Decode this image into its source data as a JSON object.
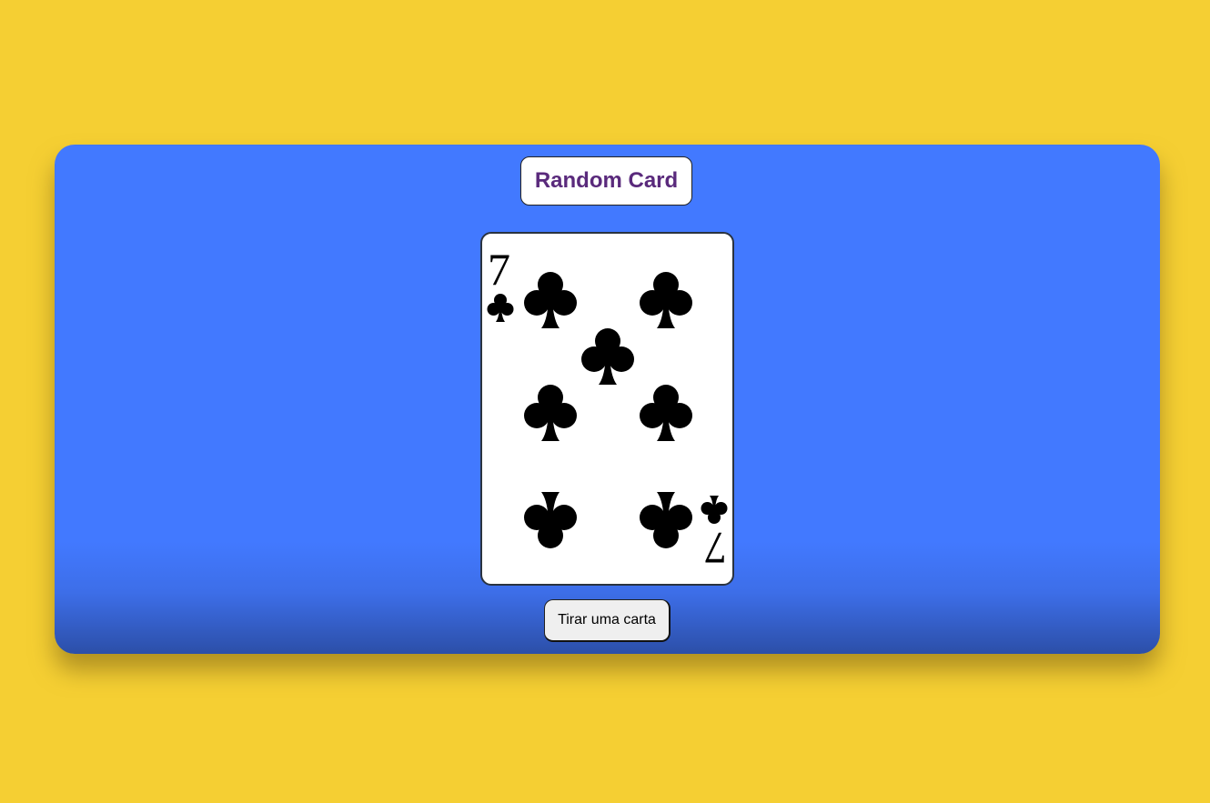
{
  "title": "Random Card",
  "card": {
    "rank": "7",
    "suit": "clubs",
    "suit_symbol": "♣",
    "suit_color": "#000000"
  },
  "button": {
    "label": "Tirar uma carta"
  },
  "colors": {
    "background": "#F5CF33",
    "panel": "#4279FF",
    "title_text": "#5A2A7C"
  }
}
